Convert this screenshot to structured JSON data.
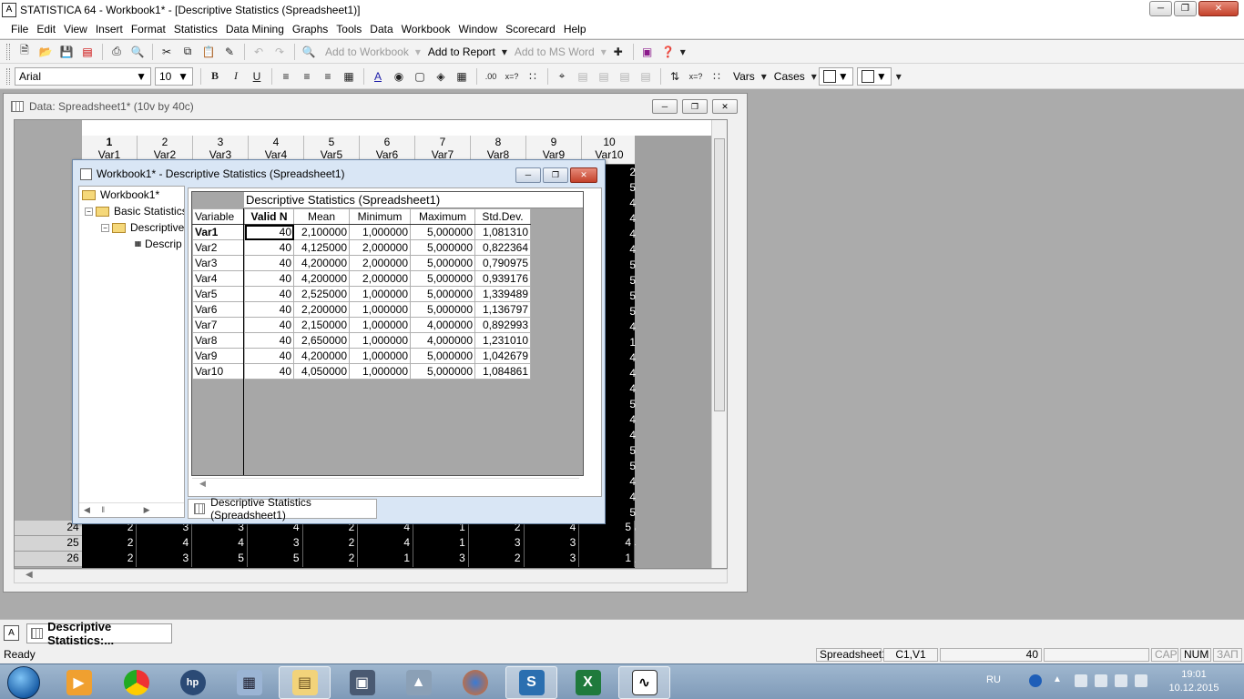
{
  "app": {
    "title": "STATISTICA 64 - Workbook1* - [Descriptive Statistics (Spreadsheet1)]",
    "logo": "A"
  },
  "menu": [
    "File",
    "Edit",
    "View",
    "Insert",
    "Format",
    "Statistics",
    "Data Mining",
    "Graphs",
    "Tools",
    "Data",
    "Workbook",
    "Window",
    "Scorecard",
    "Help"
  ],
  "toolbar1": {
    "add_to_workbook": "Add to Workbook",
    "add_to_report": "Add to Report",
    "add_to_ms_word": "Add to MS Word"
  },
  "toolbar2": {
    "font": "Arial",
    "size": "10",
    "bold": "B",
    "italic": "I",
    "underline": "U",
    "vars": "Vars",
    "cases": "Cases"
  },
  "data_window": {
    "title": "Data: Spreadsheet1* (10v by 40c)",
    "columns": [
      {
        "num": "1",
        "name": "Var1"
      },
      {
        "num": "2",
        "name": "Var2"
      },
      {
        "num": "3",
        "name": "Var3"
      },
      {
        "num": "4",
        "name": "Var4"
      },
      {
        "num": "5",
        "name": "Var5"
      },
      {
        "num": "6",
        "name": "Var6"
      },
      {
        "num": "7",
        "name": "Var7"
      },
      {
        "num": "8",
        "name": "Var8"
      },
      {
        "num": "9",
        "name": "Var9"
      },
      {
        "num": "10",
        "name": "Var10"
      }
    ],
    "right_column_values": [
      "2",
      "5",
      "4",
      "4",
      "4",
      "4",
      "5",
      "5",
      "5",
      "5",
      "4",
      "1",
      "4",
      "4",
      "4",
      "5",
      "4",
      "4",
      "5",
      "5",
      "4",
      "4",
      "5",
      "5",
      "4",
      "1"
    ],
    "left_row_digits": [
      "1",
      "1",
      "1",
      "1",
      "1",
      "1",
      "1",
      "1",
      "1",
      "1",
      "1",
      "2",
      "2",
      "2",
      "2"
    ],
    "visible_rows": [
      {
        "num": "24",
        "cells": [
          "2",
          "3",
          "3",
          "4",
          "2",
          "4",
          "1",
          "2",
          "4",
          "5"
        ]
      },
      {
        "num": "25",
        "cells": [
          "2",
          "4",
          "4",
          "3",
          "2",
          "4",
          "1",
          "3",
          "3",
          "4"
        ]
      },
      {
        "num": "26",
        "cells": [
          "2",
          "3",
          "5",
          "5",
          "2",
          "1",
          "3",
          "2",
          "3",
          "1"
        ]
      }
    ]
  },
  "workbook_window": {
    "title": "Workbook1* - Descriptive Statistics (Spreadsheet1)",
    "tree": {
      "root": "Workbook1*",
      "child": "Basic Statistics",
      "grandchild": "Descriptive",
      "leaf": "Descrip"
    },
    "output_tab": "Descriptive Statistics (Spreadsheet1)"
  },
  "results": {
    "caption": "Descriptive Statistics (Spreadsheet1)",
    "headers": [
      "Variable",
      "Valid N",
      "Mean",
      "Minimum",
      "Maximum",
      "Std.Dev."
    ],
    "rows": [
      {
        "variable": "Var1",
        "n": "40",
        "mean": "2,100000",
        "min": "1,000000",
        "max": "5,000000",
        "sd": "1,081310"
      },
      {
        "variable": "Var2",
        "n": "40",
        "mean": "4,125000",
        "min": "2,000000",
        "max": "5,000000",
        "sd": "0,822364"
      },
      {
        "variable": "Var3",
        "n": "40",
        "mean": "4,200000",
        "min": "2,000000",
        "max": "5,000000",
        "sd": "0,790975"
      },
      {
        "variable": "Var4",
        "n": "40",
        "mean": "4,200000",
        "min": "2,000000",
        "max": "5,000000",
        "sd": "0,939176"
      },
      {
        "variable": "Var5",
        "n": "40",
        "mean": "2,525000",
        "min": "1,000000",
        "max": "5,000000",
        "sd": "1,339489"
      },
      {
        "variable": "Var6",
        "n": "40",
        "mean": "2,200000",
        "min": "1,000000",
        "max": "5,000000",
        "sd": "1,136797"
      },
      {
        "variable": "Var7",
        "n": "40",
        "mean": "2,150000",
        "min": "1,000000",
        "max": "4,000000",
        "sd": "0,892993"
      },
      {
        "variable": "Var8",
        "n": "40",
        "mean": "2,650000",
        "min": "1,000000",
        "max": "4,000000",
        "sd": "1,231010"
      },
      {
        "variable": "Var9",
        "n": "40",
        "mean": "4,200000",
        "min": "1,000000",
        "max": "5,000000",
        "sd": "1,042679"
      },
      {
        "variable": "Var10",
        "n": "40",
        "mean": "4,050000",
        "min": "1,000000",
        "max": "5,000000",
        "sd": "1,084861"
      }
    ]
  },
  "doc_tab": "Descriptive Statistics:...",
  "status": {
    "ready": "Ready",
    "sheet": "Spreadsheet1",
    "cell": "C1,V1",
    "value": "40",
    "cap": "CAP",
    "num": "NUM",
    "scrl": "ЗАП"
  },
  "taskbar": {
    "lang": "RU",
    "time": "19:01",
    "date": "10.12.2015"
  }
}
